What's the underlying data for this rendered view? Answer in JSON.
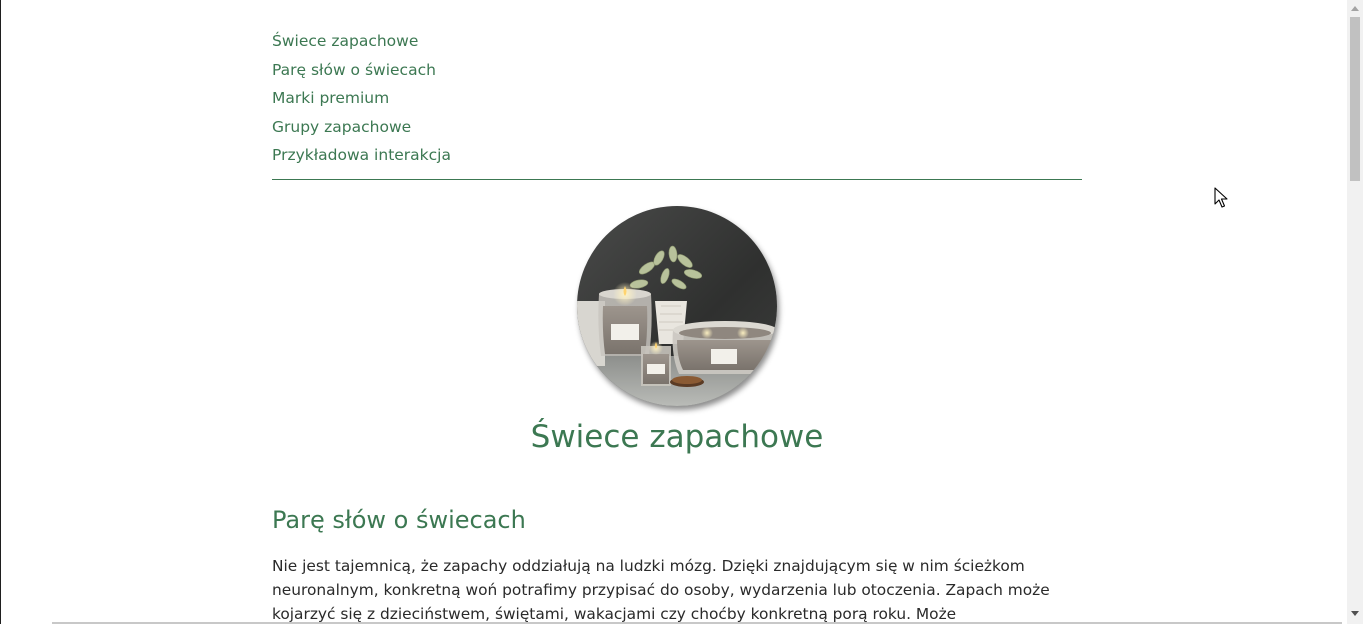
{
  "toc": {
    "items": [
      {
        "label": "Świece zapachowe"
      },
      {
        "label": "Parę słów o świecach"
      },
      {
        "label": "Marki premium"
      },
      {
        "label": "Grupy zapachowe"
      },
      {
        "label": "Przykładowa interakcja"
      }
    ]
  },
  "hero": {
    "image_subject": "scented candles in glass jars",
    "title": "Świece zapachowe"
  },
  "section": {
    "heading": "Parę słów o świecach",
    "paragraph": "Nie jest tajemnicą, że zapachy oddziałują na ludzki mózg. Dzięki znajdującym się w nim ścieżkom neuronalnym, konkretną woń potrafimy przypisać do osoby, wydarzenia lub otoczenia. Zapach może kojarzyć się z dzieciństwem, świętami, wakacjami czy choćby konkretną porą roku. Może"
  },
  "colors": {
    "accent": "#3c7852",
    "text": "#2a2a2a",
    "background": "#ffffff"
  },
  "icons": {
    "cursor": "arrow-cursor-icon",
    "scroll_up": "chevron-up-icon",
    "scroll_down": "chevron-down-icon"
  }
}
